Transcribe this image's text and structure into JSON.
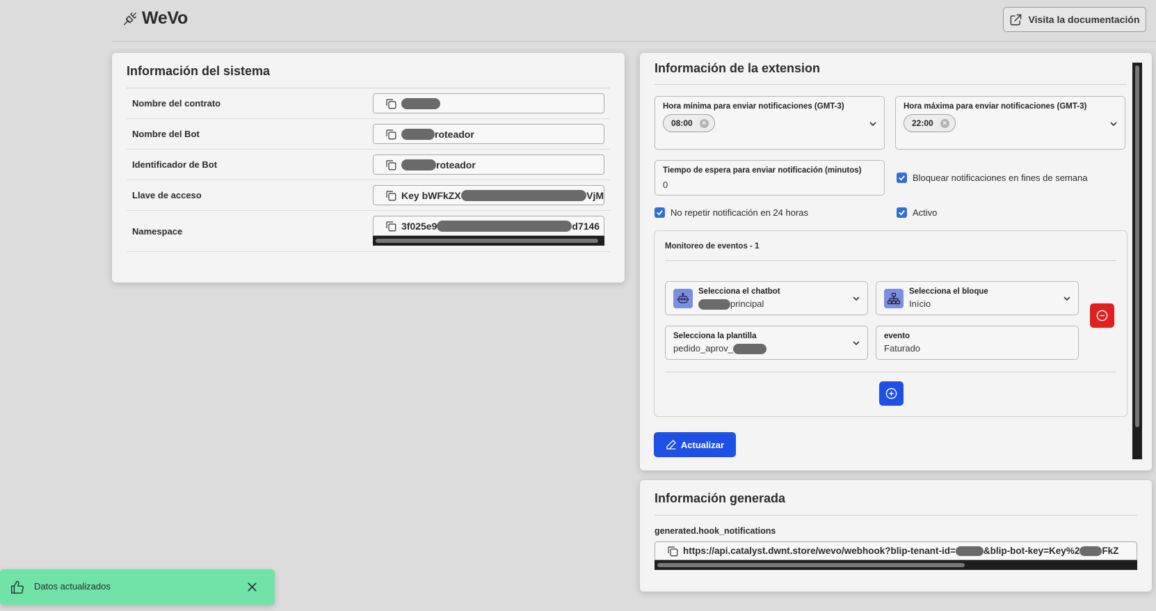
{
  "app": {
    "name": "WeVo",
    "doc_button": "Visita la documentación"
  },
  "system": {
    "title": "Información del sistema",
    "rows": [
      {
        "label": "Nombre del contrato",
        "value": ""
      },
      {
        "label": "Nombre del Bot",
        "value": "roteador"
      },
      {
        "label": "Identificador de Bot",
        "value": "roteador"
      },
      {
        "label": "Llave de acceso",
        "value_prefix": "Key bWFkZX",
        "value_suffix": "VjM"
      },
      {
        "label": "Namespace",
        "value_prefix": "3f025e9",
        "value_suffix": "d7146"
      }
    ]
  },
  "extension": {
    "title": "Información de la extension",
    "min_hour": {
      "label": "Hora mínima para enviar notificaciones (GMT-3)",
      "value": "08:00"
    },
    "max_hour": {
      "label": "Hora máxima para enviar notificaciones (GMT-3)",
      "value": "22:00"
    },
    "wait_time": {
      "label": "Tiempo de espera para enviar notificación (minutos)",
      "value": "0"
    },
    "checks": {
      "block_weekends": "Bloquear notificaciones en fines de semana",
      "no_repeat": "No repetir notificación en 24 horas",
      "active": "Activo"
    },
    "monitor": {
      "title": "Monitoreo de eventos - 1",
      "chatbot": {
        "label": "Selecciona el chatbot",
        "value": "principal"
      },
      "block": {
        "label": "Selecciona el bloque",
        "value": "Início"
      },
      "template": {
        "label": "Selecciona la plantilla",
        "value": "pedido_aprov_"
      },
      "event": {
        "label": "evento",
        "value": "Faturado"
      }
    },
    "update_button": "Actualizar"
  },
  "generated": {
    "title": "Información generada",
    "hook_label": "generated.hook_notifications",
    "url_part1": "https://api.catalyst.dwnt.store/wevo/webhook?blip-tenant-id=",
    "url_part2": "&blip-bot-key=Key%2",
    "url_part3": "FkZ"
  },
  "toast": {
    "message": "Datos actualizados"
  }
}
